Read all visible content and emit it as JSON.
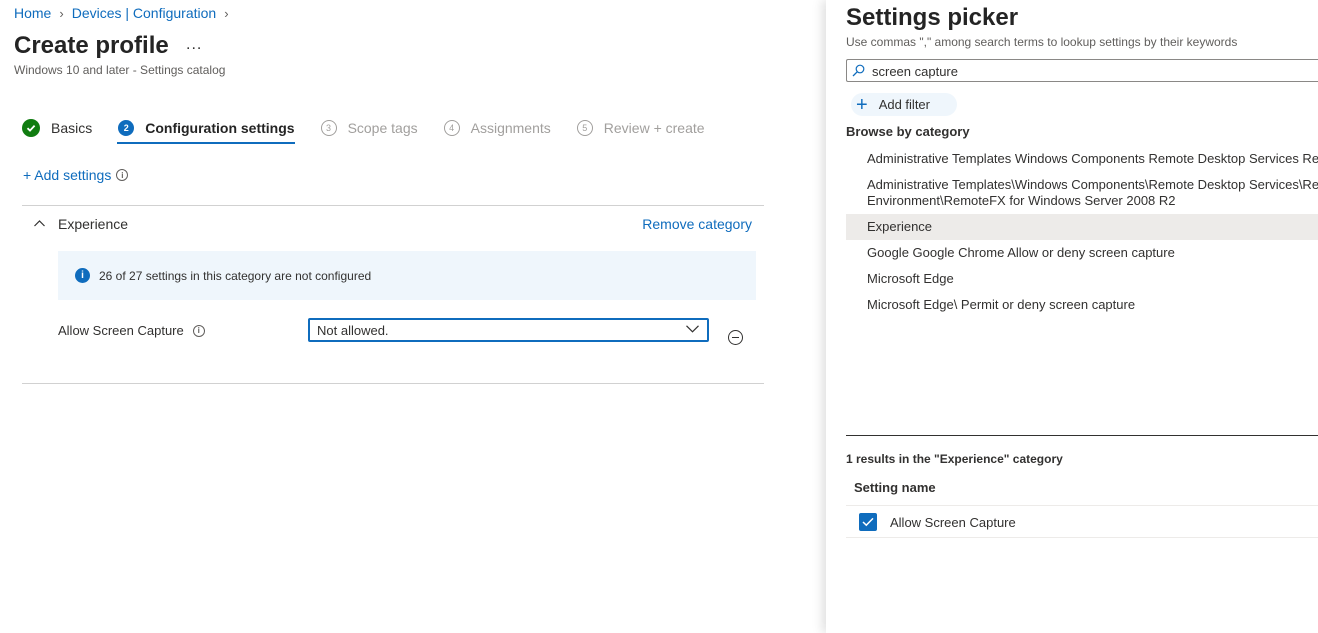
{
  "breadcrumb": {
    "home": "Home",
    "devices": "Devices | Configuration"
  },
  "page": {
    "title": "Create profile",
    "more": "...",
    "subtitle": "Windows 10 and later - Settings catalog"
  },
  "steps": [
    {
      "num": "",
      "label": "Basics",
      "state": "done"
    },
    {
      "num": "2",
      "label": "Configuration settings",
      "state": "active"
    },
    {
      "num": "3",
      "label": "Scope tags",
      "state": "pending"
    },
    {
      "num": "4",
      "label": "Assignments",
      "state": "pending"
    },
    {
      "num": "5",
      "label": "Review + create",
      "state": "pending"
    }
  ],
  "add_settings": {
    "label": "+ Add settings"
  },
  "category": {
    "name": "Experience",
    "remove_label": "Remove category",
    "info": "26 of 27 settings in this category are not configured",
    "setting": {
      "label": "Allow Screen Capture",
      "value": "Not allowed."
    }
  },
  "picker": {
    "title": "Settings picker",
    "hint": "Use commas \",\" among search terms to lookup settings by their keywords",
    "search_value": "screen capture",
    "add_filter": "Add filter",
    "browse_title": "Browse by category",
    "categories": [
      {
        "line1": "Administrative Templates Windows Components Remote Desktop Services Remote Desktop Session Host Remote Session Environment",
        "line2": ""
      },
      {
        "line1": "Administrative Templates\\Windows Components\\Remote Desktop Services\\Remote Desktop Session Host\\Remote Session",
        "line2": "Environment\\RemoteFX for Windows Server 2008 R2"
      },
      {
        "line1": "Experience",
        "line2": ""
      },
      {
        "line1": "Google Google Chrome Allow or deny screen capture",
        "line2": ""
      },
      {
        "line1": "Microsoft Edge",
        "line2": ""
      },
      {
        "line1": "Microsoft Edge\\ Permit or deny screen capture",
        "line2": ""
      }
    ],
    "selected_category_index": 2,
    "results_title": "1 results in the \"Experience\" category",
    "column_header": "Setting name",
    "results": [
      {
        "label": "Allow Screen Capture",
        "checked": true
      }
    ]
  },
  "colors": {
    "accent": "#0f6cbd",
    "success": "#107c10",
    "info_bg": "#eff6fc",
    "selected_bg": "#edebe9"
  }
}
